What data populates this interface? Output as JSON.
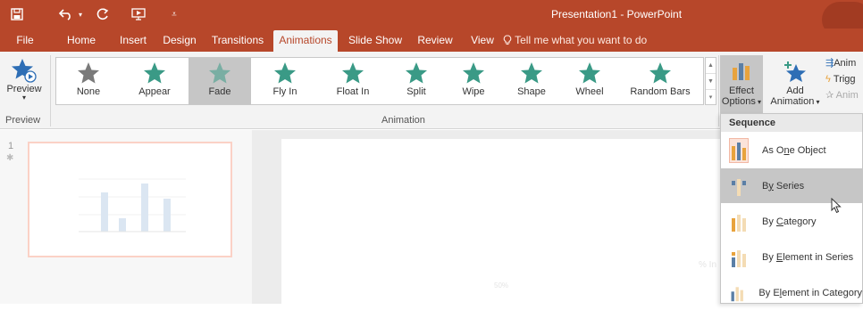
{
  "titlebar": {
    "title": "Presentation1 - PowerPoint"
  },
  "tabs": [
    {
      "label": "File"
    },
    {
      "label": "Home"
    },
    {
      "label": "Insert"
    },
    {
      "label": "Design"
    },
    {
      "label": "Transitions"
    },
    {
      "label": "Animations"
    },
    {
      "label": "Slide Show"
    },
    {
      "label": "Review"
    },
    {
      "label": "View"
    }
  ],
  "tell_me": "Tell me what you want to do",
  "ribbon": {
    "preview": {
      "label": "Preview",
      "group": "Preview"
    },
    "animation_group": "Animation",
    "animations": [
      {
        "label": "None",
        "color": "#7a7a7a"
      },
      {
        "label": "Appear",
        "color": "#3a9a86"
      },
      {
        "label": "Fade",
        "color": "#3a9a86"
      },
      {
        "label": "Fly In",
        "color": "#3a9a86"
      },
      {
        "label": "Float In",
        "color": "#3a9a86"
      },
      {
        "label": "Split",
        "color": "#3a9a86"
      },
      {
        "label": "Wipe",
        "color": "#3a9a86"
      },
      {
        "label": "Shape",
        "color": "#3a9a86"
      },
      {
        "label": "Wheel",
        "color": "#3a9a86"
      },
      {
        "label": "Random Bars",
        "color": "#3a9a86"
      }
    ],
    "selected_animation": "Fade",
    "effect_options": {
      "line1": "Effect",
      "line2": "Options"
    },
    "add_animation": {
      "line1": "Add",
      "line2": "Animation"
    },
    "side_commands": [
      "Anim",
      "Trigg",
      "Anim"
    ]
  },
  "thumbnail": {
    "slide_number": "1"
  },
  "dropdown": {
    "header": "Sequence",
    "items": [
      {
        "pre": "As O",
        "key": "n",
        "post": "e Object"
      },
      {
        "pre": "B",
        "key": "y",
        "post": " Series"
      },
      {
        "pre": "By ",
        "key": "C",
        "post": "ategory"
      },
      {
        "pre": "By ",
        "key": "E",
        "post": "lement in Series"
      },
      {
        "pre": "By E",
        "key": "l",
        "post": "ement in Category"
      }
    ],
    "hovered": "By Series"
  },
  "colors": {
    "accent": "#b7472a",
    "ribbon_bg": "#f3f3f3",
    "selected_bg": "#c6c6c6"
  }
}
